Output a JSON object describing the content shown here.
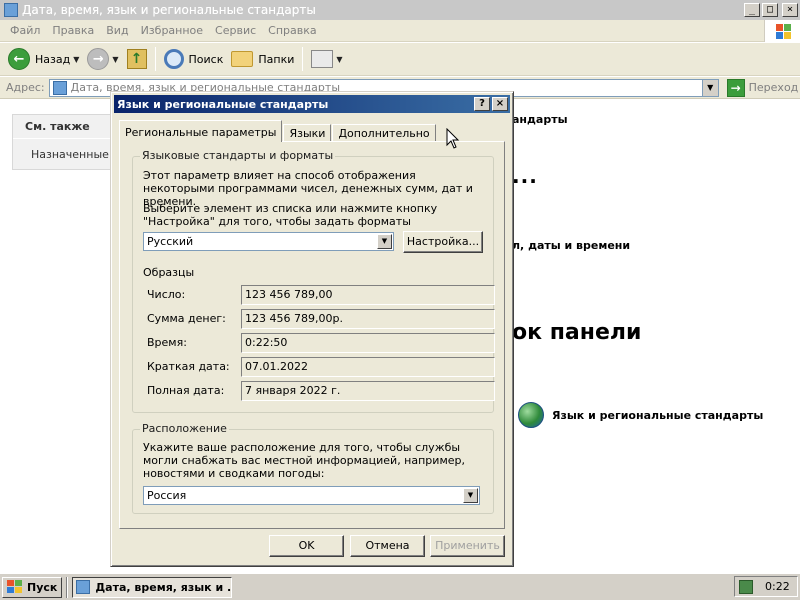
{
  "window": {
    "title": "Дата, время, язык и региональные стандарты",
    "caption_buttons": {
      "minimize": "_",
      "maximize": "□",
      "close": "×"
    }
  },
  "menubar": [
    "Файл",
    "Правка",
    "Вид",
    "Избранное",
    "Сервис",
    "Справка"
  ],
  "toolbar": {
    "back": "Назад",
    "search": "Поиск",
    "folders": "Папки"
  },
  "address": {
    "label": "Адрес:",
    "value": "Дата, время, язык и региональные стандарты",
    "go": "Переход"
  },
  "content": {
    "see_also_title": "См. также",
    "see_also_item": "Назначенные задачи",
    "bg_text1": "андарты",
    "bg_dots": "...",
    "bg_text2": "л, даты и времени",
    "bg_big": "ок панели",
    "cpl_item": "Язык и региональные стандарты"
  },
  "dialog": {
    "title": "Язык и региональные стандарты",
    "help": "?",
    "close": "×",
    "tabs": [
      "Региональные параметры",
      "Языки",
      "Дополнительно"
    ],
    "formats_group": {
      "legend": "Языковые стандарты и форматы",
      "desc": "Этот параметр влияет на способ отображения некоторыми программами чисел, денежных сумм, дат и времени.",
      "select_desc": "Выберите элемент из списка или нажмите кнопку \"Настройка\" для того, чтобы задать форматы самостоятельно:",
      "locale_value": "Русский",
      "customize_button": "Настройка...",
      "samples_label": "Образцы",
      "samples": [
        {
          "label": "Число:",
          "value": "123 456 789,00"
        },
        {
          "label": "Сумма денег:",
          "value": "123 456 789,00р."
        },
        {
          "label": "Время:",
          "value": "0:22:50"
        },
        {
          "label": "Краткая дата:",
          "value": "07.01.2022"
        },
        {
          "label": "Полная дата:",
          "value": "7 января 2022 г."
        }
      ]
    },
    "location_group": {
      "legend": "Расположение",
      "desc": "Укажите ваше расположение для того, чтобы службы могли снабжать вас местной информацией, например, новостями и сводками погоды:",
      "location_value": "Россия"
    },
    "buttons": {
      "ok": "OK",
      "cancel": "Отмена",
      "apply": "Применить"
    }
  },
  "taskbar": {
    "start": "Пуск",
    "task": "Дата, время, язык и ...",
    "clock": "0:22"
  },
  "colors": {
    "dialog_title_start": "#0a246a",
    "dialog_title_end": "#3a6ea5",
    "face": "#ece9d8"
  }
}
